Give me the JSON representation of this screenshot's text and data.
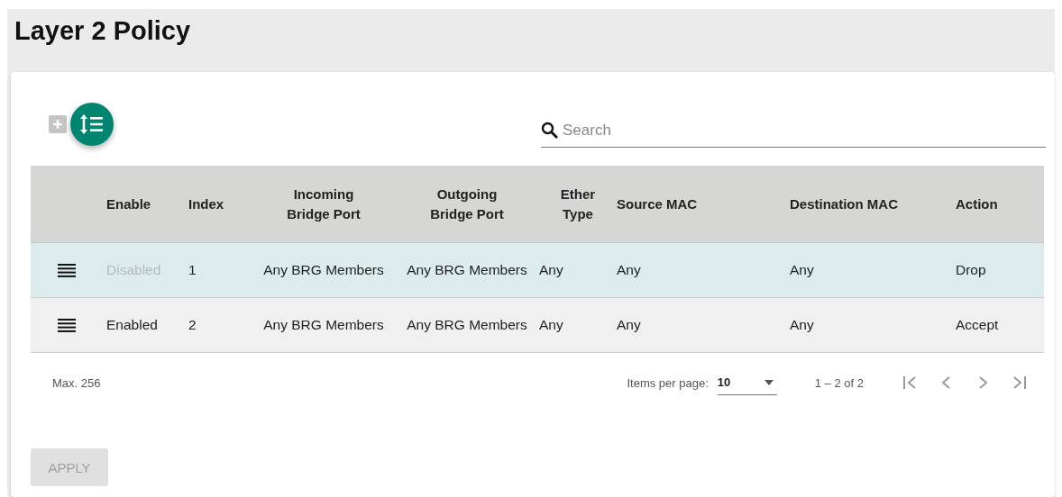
{
  "page": {
    "title": "Layer 2 Policy"
  },
  "toolbar": {
    "add_button": {
      "disabled": true
    },
    "search": {
      "placeholder": "Search"
    }
  },
  "table": {
    "columns": [
      "Enable",
      "Index",
      "Incoming Bridge Port",
      "Outgoing Bridge Port",
      "Ether Type",
      "Source MAC",
      "Destination MAC",
      "Action"
    ],
    "rows": [
      {
        "selected": true,
        "enabled": false,
        "cells": [
          "Disabled",
          "1",
          "Any BRG Members",
          "Any BRG Members",
          "Any",
          "Any",
          "Any",
          "Drop"
        ]
      },
      {
        "selected": false,
        "enabled": true,
        "cells": [
          "Enabled",
          "2",
          "Any BRG Members",
          "Any BRG Members",
          "Any",
          "Any",
          "Any",
          "Accept"
        ]
      }
    ]
  },
  "footer": {
    "max": "Max. 256",
    "items_per_page_label": "Items per page:",
    "items_per_page": "10",
    "range": "1 – 2 of 2"
  },
  "apply_button": {
    "label": "APPLY",
    "disabled": true
  }
}
